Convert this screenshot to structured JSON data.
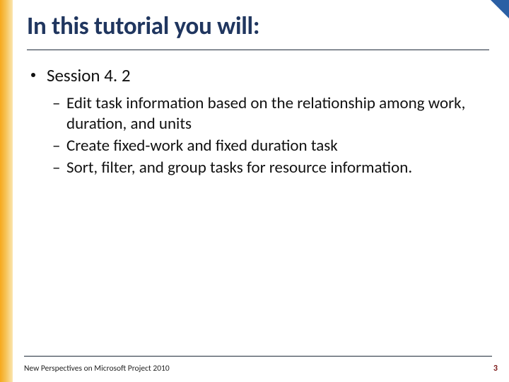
{
  "title": "In this tutorial you will:",
  "bullets": {
    "level1": "Session 4. 2",
    "level2": [
      "Edit task information based on the relationship among work, duration, and units",
      "Create fixed-work and fixed duration task",
      "Sort, filter, and group tasks for resource information."
    ]
  },
  "footer": {
    "left": "New Perspectives on Microsoft Project 2010",
    "page": "3"
  },
  "colors": {
    "title": "#20365f",
    "accent_bar": "#f6a81c",
    "corner": "#2a5fa4",
    "page_number": "#7a1616"
  }
}
